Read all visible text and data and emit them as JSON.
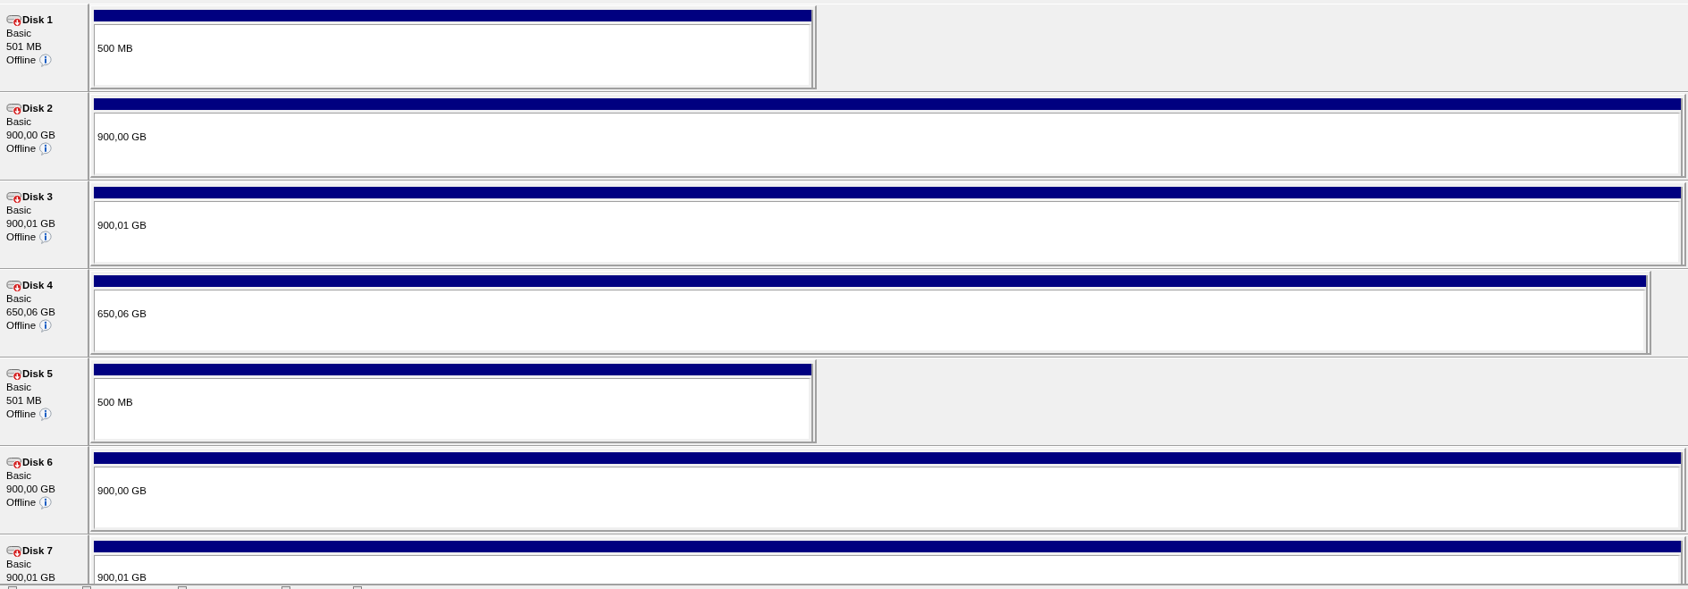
{
  "disks": [
    {
      "name": "Disk 1",
      "type": "Basic",
      "capacity": "501 MB",
      "status": "Offline",
      "partition": {
        "size": "500 MB",
        "level": 0.455
      }
    },
    {
      "name": "Disk 2",
      "type": "Basic",
      "capacity": "900,00 GB",
      "status": "Offline",
      "partition": {
        "size": "900,00 GB",
        "level": 1
      }
    },
    {
      "name": "Disk 3",
      "type": "Basic",
      "capacity": "900,01 GB",
      "status": "Offline",
      "partition": {
        "size": "900,01 GB",
        "level": 1
      }
    },
    {
      "name": "Disk 4",
      "type": "Basic",
      "capacity": "650,06 GB",
      "status": "Offline",
      "partition": {
        "size": "650,06 GB",
        "level": 0.978
      }
    },
    {
      "name": "Disk 5",
      "type": "Basic",
      "capacity": "501 MB",
      "status": "Offline",
      "partition": {
        "size": "500 MB",
        "level": 0.455
      }
    },
    {
      "name": "Disk 6",
      "type": "Basic",
      "capacity": "900,00 GB",
      "status": "Offline",
      "partition": {
        "size": "900,00 GB",
        "level": 1
      }
    },
    {
      "name": "Disk 7",
      "type": "Basic",
      "capacity": "900,01 GB",
      "partition": {
        "size": "900,01 GB",
        "level": 1
      }
    }
  ]
}
